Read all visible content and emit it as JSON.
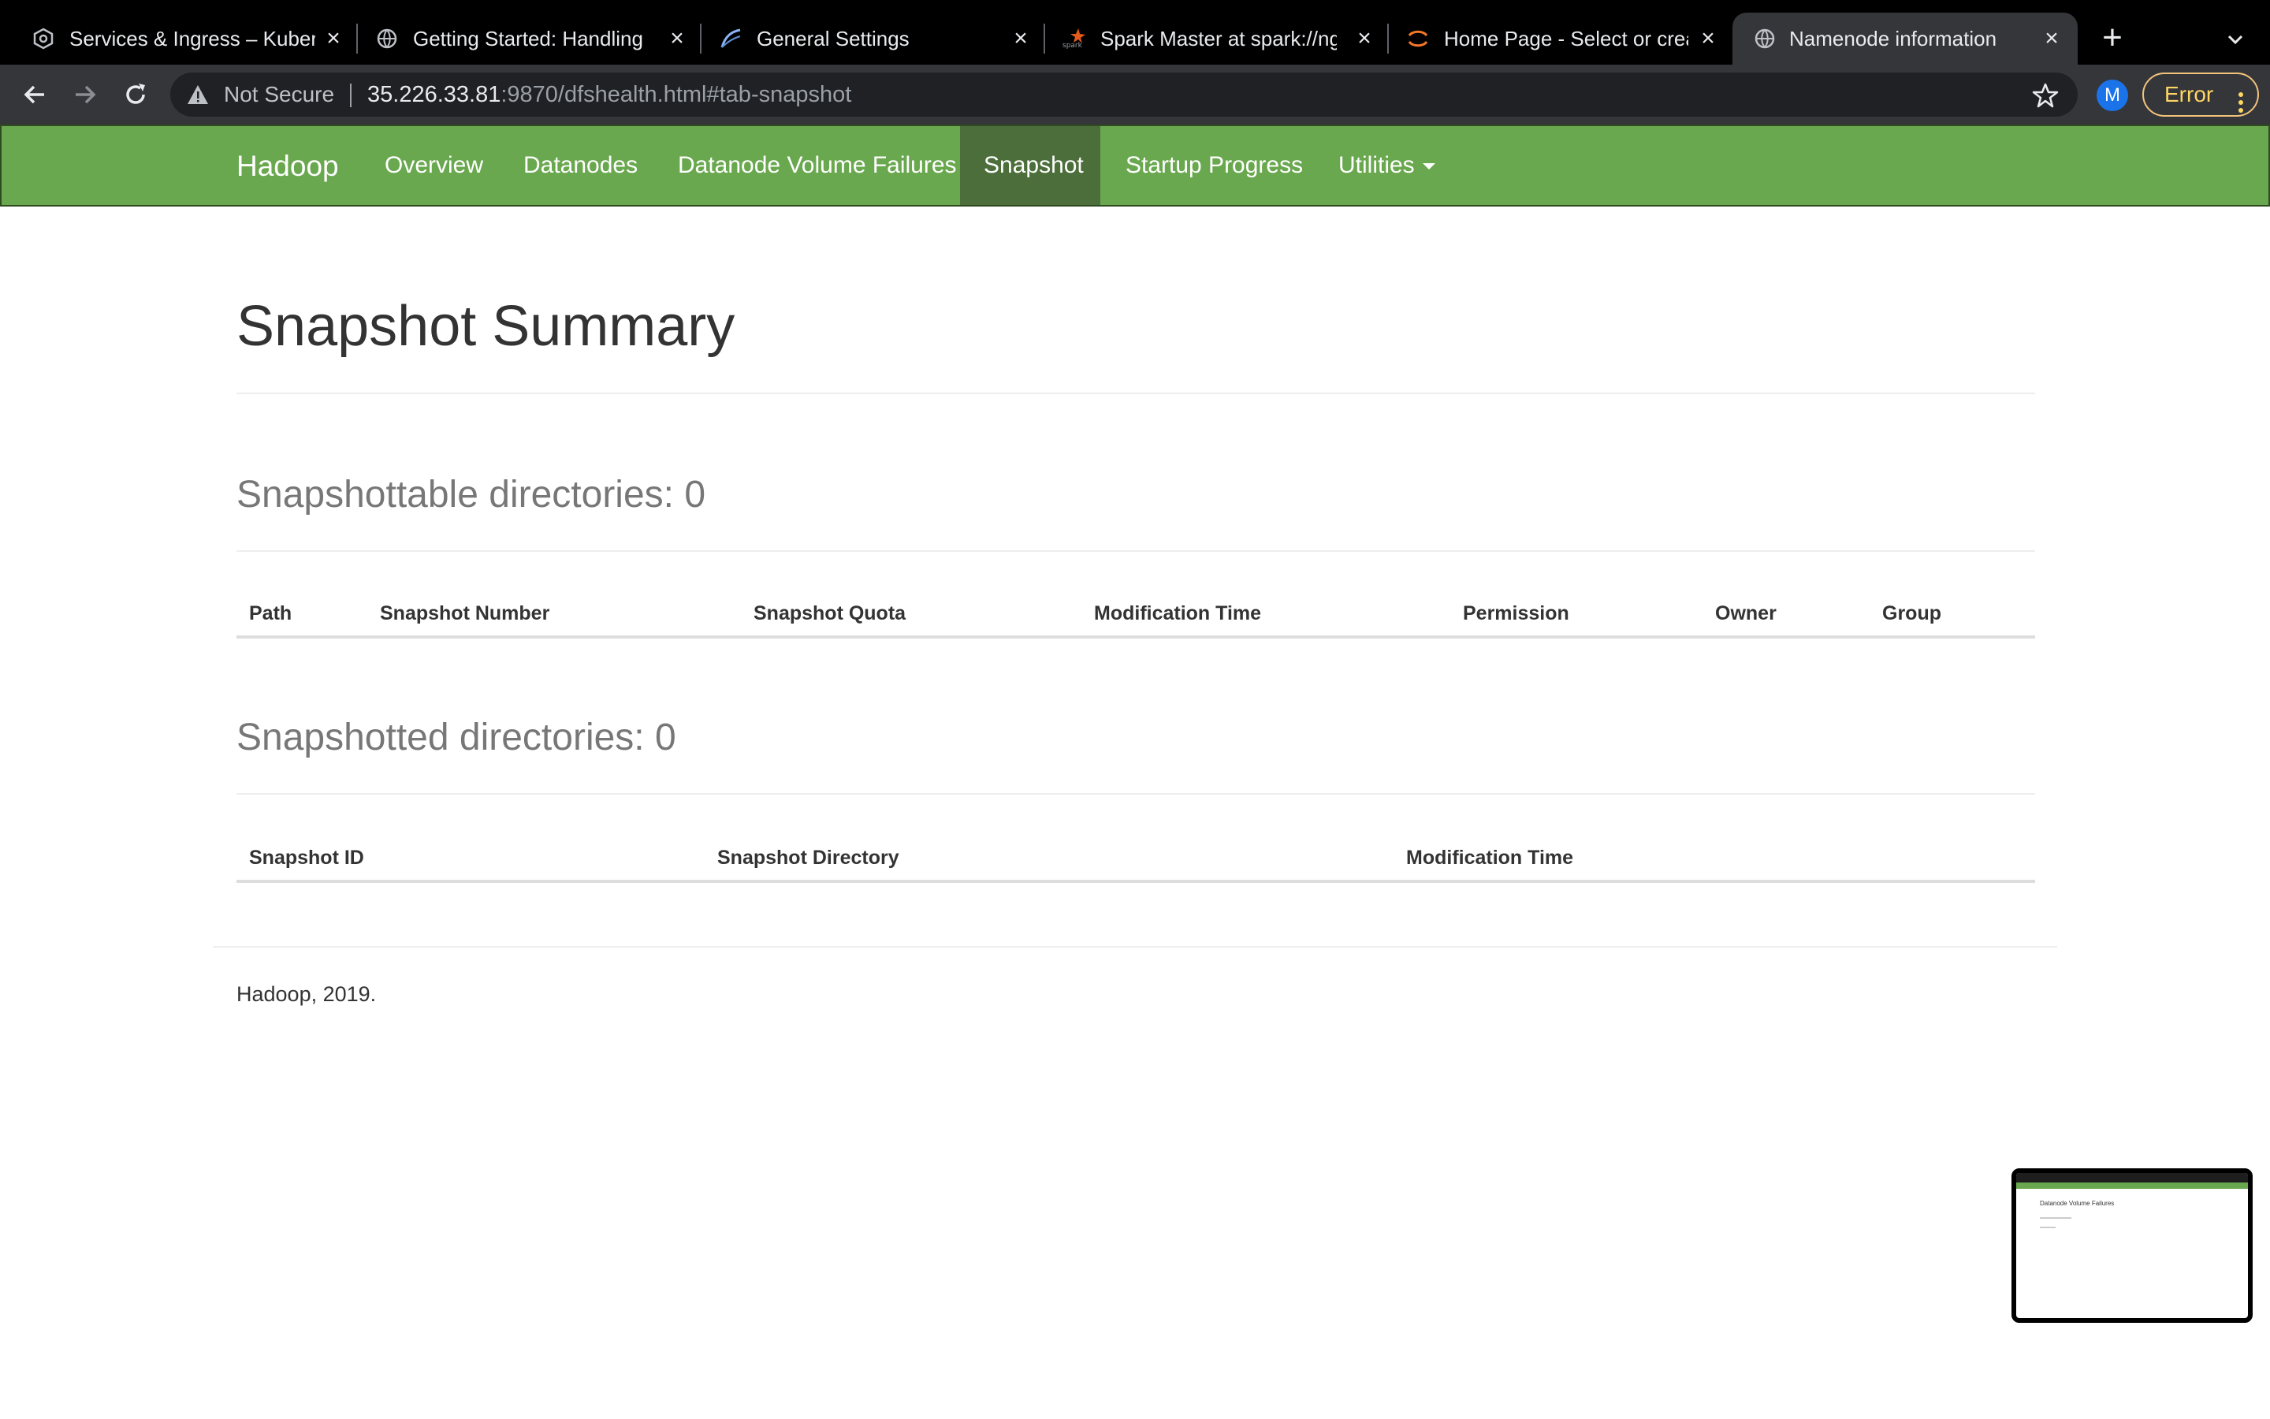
{
  "browser": {
    "tabs": [
      {
        "title": "Services & Ingress – Kuberr",
        "icon": "kubernetes-icon"
      },
      {
        "title": "Getting Started: Handling F",
        "icon": "globe-icon"
      },
      {
        "title": "General Settings",
        "icon": "airflow-icon"
      },
      {
        "title": "Spark Master at spark://ngi",
        "icon": "spark-icon"
      },
      {
        "title": "Home Page - Select or crea",
        "icon": "jupyter-icon"
      },
      {
        "title": "Namenode information",
        "icon": "globe-icon",
        "active": true
      }
    ],
    "new_tab_label": "+",
    "security_label": "Not Secure",
    "url_host": "35.226.33.81",
    "url_path": ":9870/dfshealth.html#tab-snapshot",
    "profile_initial": "M",
    "error_label": "Error"
  },
  "navbar": {
    "brand": "Hadoop",
    "items": [
      {
        "label": "Overview"
      },
      {
        "label": "Datanodes"
      },
      {
        "label": "Datanode Volume Failures"
      },
      {
        "label": "Snapshot",
        "active": true
      },
      {
        "label": "Startup Progress"
      },
      {
        "label": "Utilities"
      }
    ],
    "accent_color": "#6aa84f",
    "active_color": "#4b6e3a"
  },
  "page": {
    "title": "Snapshot Summary",
    "snapshottable": {
      "heading": "Snapshottable directories: 0",
      "columns": [
        "Path",
        "Snapshot Number",
        "Snapshot Quota",
        "Modification Time",
        "Permission",
        "Owner",
        "Group"
      ],
      "rows": []
    },
    "snapshotted": {
      "heading": "Snapshotted directories: 0",
      "columns": [
        "Snapshot ID",
        "Snapshot Directory",
        "Modification Time"
      ],
      "rows": []
    },
    "footer": "Hadoop, 2019."
  },
  "thumbnail": {
    "title": "Datanode Volume Failures"
  }
}
